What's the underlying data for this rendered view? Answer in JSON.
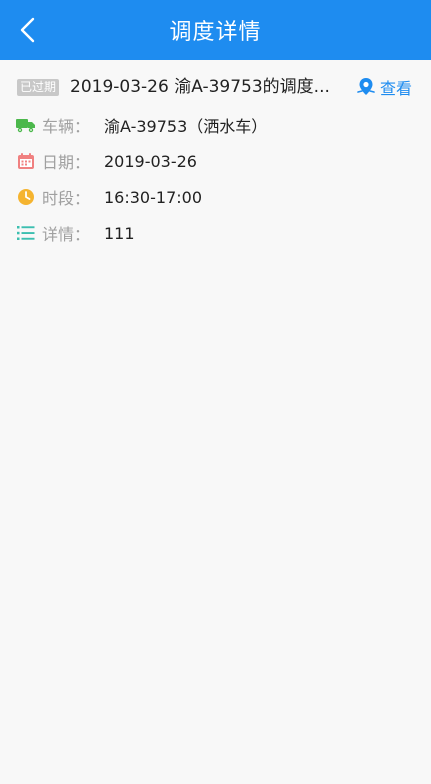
{
  "header": {
    "title": "调度详情",
    "back_icon": "chevron-left-icon"
  },
  "schedule": {
    "badge": "已过期",
    "title": "2019-03-26 渝A-39753的调度...",
    "view_label": "查看",
    "view_icon": "map-pin-icon"
  },
  "details": [
    {
      "icon": "truck-icon",
      "key": "车辆：",
      "value": "渝A-39753（洒水车）",
      "color": "#4cb84c"
    },
    {
      "icon": "calendar-icon",
      "key": "日期：",
      "value": "2019-03-26",
      "color": "#f08080"
    },
    {
      "icon": "clock-icon",
      "key": "时段：",
      "value": "16:30-17:00",
      "color": "#f5b430"
    },
    {
      "icon": "list-icon",
      "key": "详情：",
      "value": "111",
      "color": "#3cbfb0"
    }
  ],
  "colors": {
    "primary": "#1e8cf0",
    "badge_bg": "#c8c8c8"
  }
}
